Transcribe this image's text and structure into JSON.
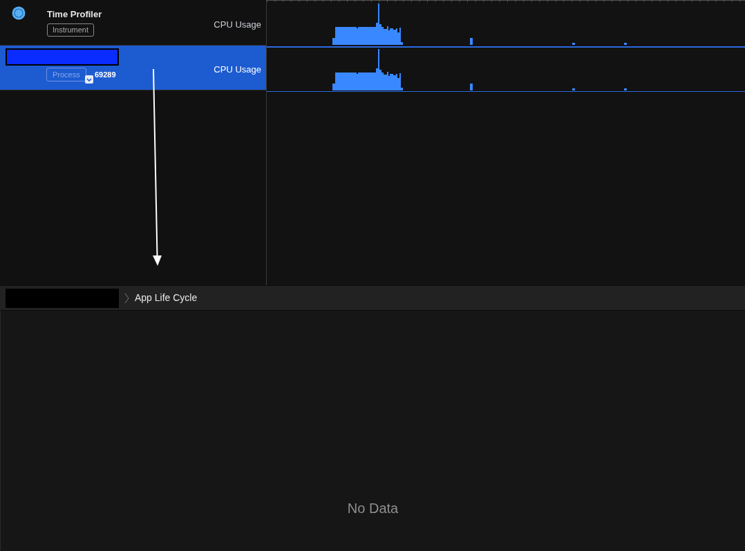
{
  "tracks": [
    {
      "kind": "instrument",
      "title": "Time Profiler",
      "badge": "Instrument",
      "metric": "CPU Usage",
      "selected": false
    },
    {
      "kind": "process",
      "badge": "Process",
      "pid": "69289",
      "metric": "CPU Usage",
      "selected": true
    }
  ],
  "breadcrumb": {
    "item": "App Life Cycle"
  },
  "detail": {
    "message": "No Data"
  }
}
